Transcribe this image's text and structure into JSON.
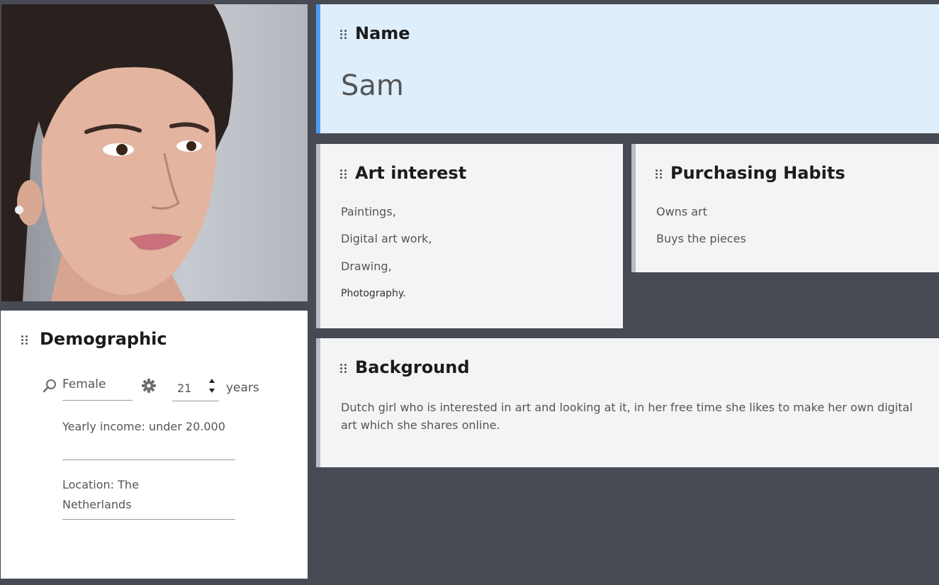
{
  "name_card": {
    "title": "Name",
    "value": "Sam"
  },
  "art_interest": {
    "title": "Art interest",
    "items": [
      "Paintings,",
      "Digital art work,",
      "Drawing,",
      "Photography."
    ]
  },
  "purchasing_habits": {
    "title": "Purchasing Habits",
    "items": [
      "Owns art",
      "Buys the pieces"
    ]
  },
  "background": {
    "title": "Background",
    "text": "Dutch girl who is interested in art and looking at it, in her free time she likes to make her own digital art which she shares online."
  },
  "demographic": {
    "title": "Demographic",
    "gender": "Female",
    "age": "21",
    "age_unit": "years",
    "income": "Yearly income: under 20.000",
    "location": "Location: The Netherlands"
  },
  "colors": {
    "page_bg": "#474a52",
    "name_card_bg": "#deeefb",
    "name_accent": "#4a9cf2",
    "card_bg": "#f3f4f6",
    "card_accent": "#b7bcc4"
  },
  "icons": [
    "drag-handle-icon",
    "search-icon",
    "gear-icon",
    "spinner-arrows-icon"
  ]
}
